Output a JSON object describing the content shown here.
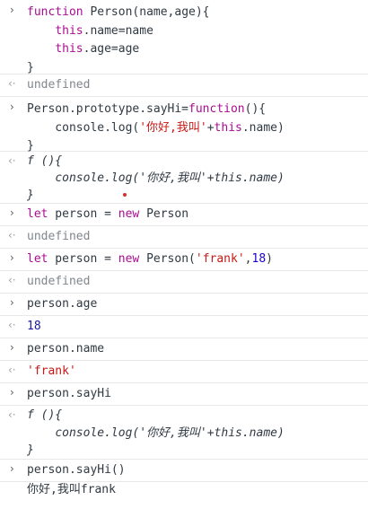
{
  "console": {
    "entries": [
      {
        "type": "input",
        "lines": [
          "function Person(name,age){",
          "    this.name=name",
          "    this.age=age",
          "}"
        ]
      },
      {
        "type": "output",
        "text": "undefined"
      },
      {
        "type": "input",
        "lines": [
          "Person.prototype.sayHi=function(){",
          "    console.log('你好,我叫'+this.name)",
          "}"
        ]
      },
      {
        "type": "output",
        "lines": [
          "f (){",
          "    console.log('你好,我叫'+this.name)",
          "}"
        ]
      },
      {
        "type": "input",
        "text": "let person = new Person"
      },
      {
        "type": "output",
        "text": "undefined"
      },
      {
        "type": "input",
        "text": "let person = new Person('frank',18)"
      },
      {
        "type": "output",
        "text": "undefined"
      },
      {
        "type": "input",
        "text": "person.age"
      },
      {
        "type": "output",
        "text": "18"
      },
      {
        "type": "input",
        "text": "person.name"
      },
      {
        "type": "output",
        "text": "'frank'"
      },
      {
        "type": "input",
        "text": "person.sayHi"
      },
      {
        "type": "output",
        "lines": [
          "f (){",
          "    console.log('你好,我叫'+this.name)",
          "}"
        ]
      },
      {
        "type": "input",
        "text": "person.sayHi()"
      },
      {
        "type": "output",
        "text": "你好,我叫frank"
      }
    ],
    "prompt_input": "›",
    "prompt_output": "‹·"
  }
}
